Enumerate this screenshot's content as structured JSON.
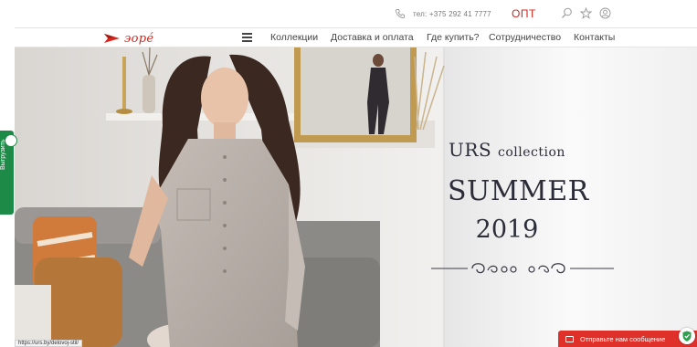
{
  "topbar": {
    "phone_label": "тел: +375 292 41 7777",
    "opt_label": "ОПТ",
    "icons": [
      "phone-icon",
      "search-icon",
      "star-icon",
      "user-icon"
    ]
  },
  "nav": {
    "logo_text": "эорé",
    "items": [
      {
        "label": "Коллекции"
      },
      {
        "label": "Доставка и оплата"
      },
      {
        "label": "Где купить?"
      },
      {
        "label": "Сотрудничество"
      },
      {
        "label": "Контакты"
      }
    ]
  },
  "hero": {
    "line1_main": "URS",
    "line1_small": "collection",
    "line2": "SUMMER",
    "line3": "2019"
  },
  "side_tab": {
    "label": "Выгрузить"
  },
  "status_bar": {
    "url": "https://urs.by/delovoj-stil/"
  },
  "chat": {
    "label": "Отправьте нам сообщение"
  },
  "colors": {
    "brand_red": "#d6261d",
    "tab_green": "#1d8a47",
    "chat_red": "#e0302a"
  }
}
